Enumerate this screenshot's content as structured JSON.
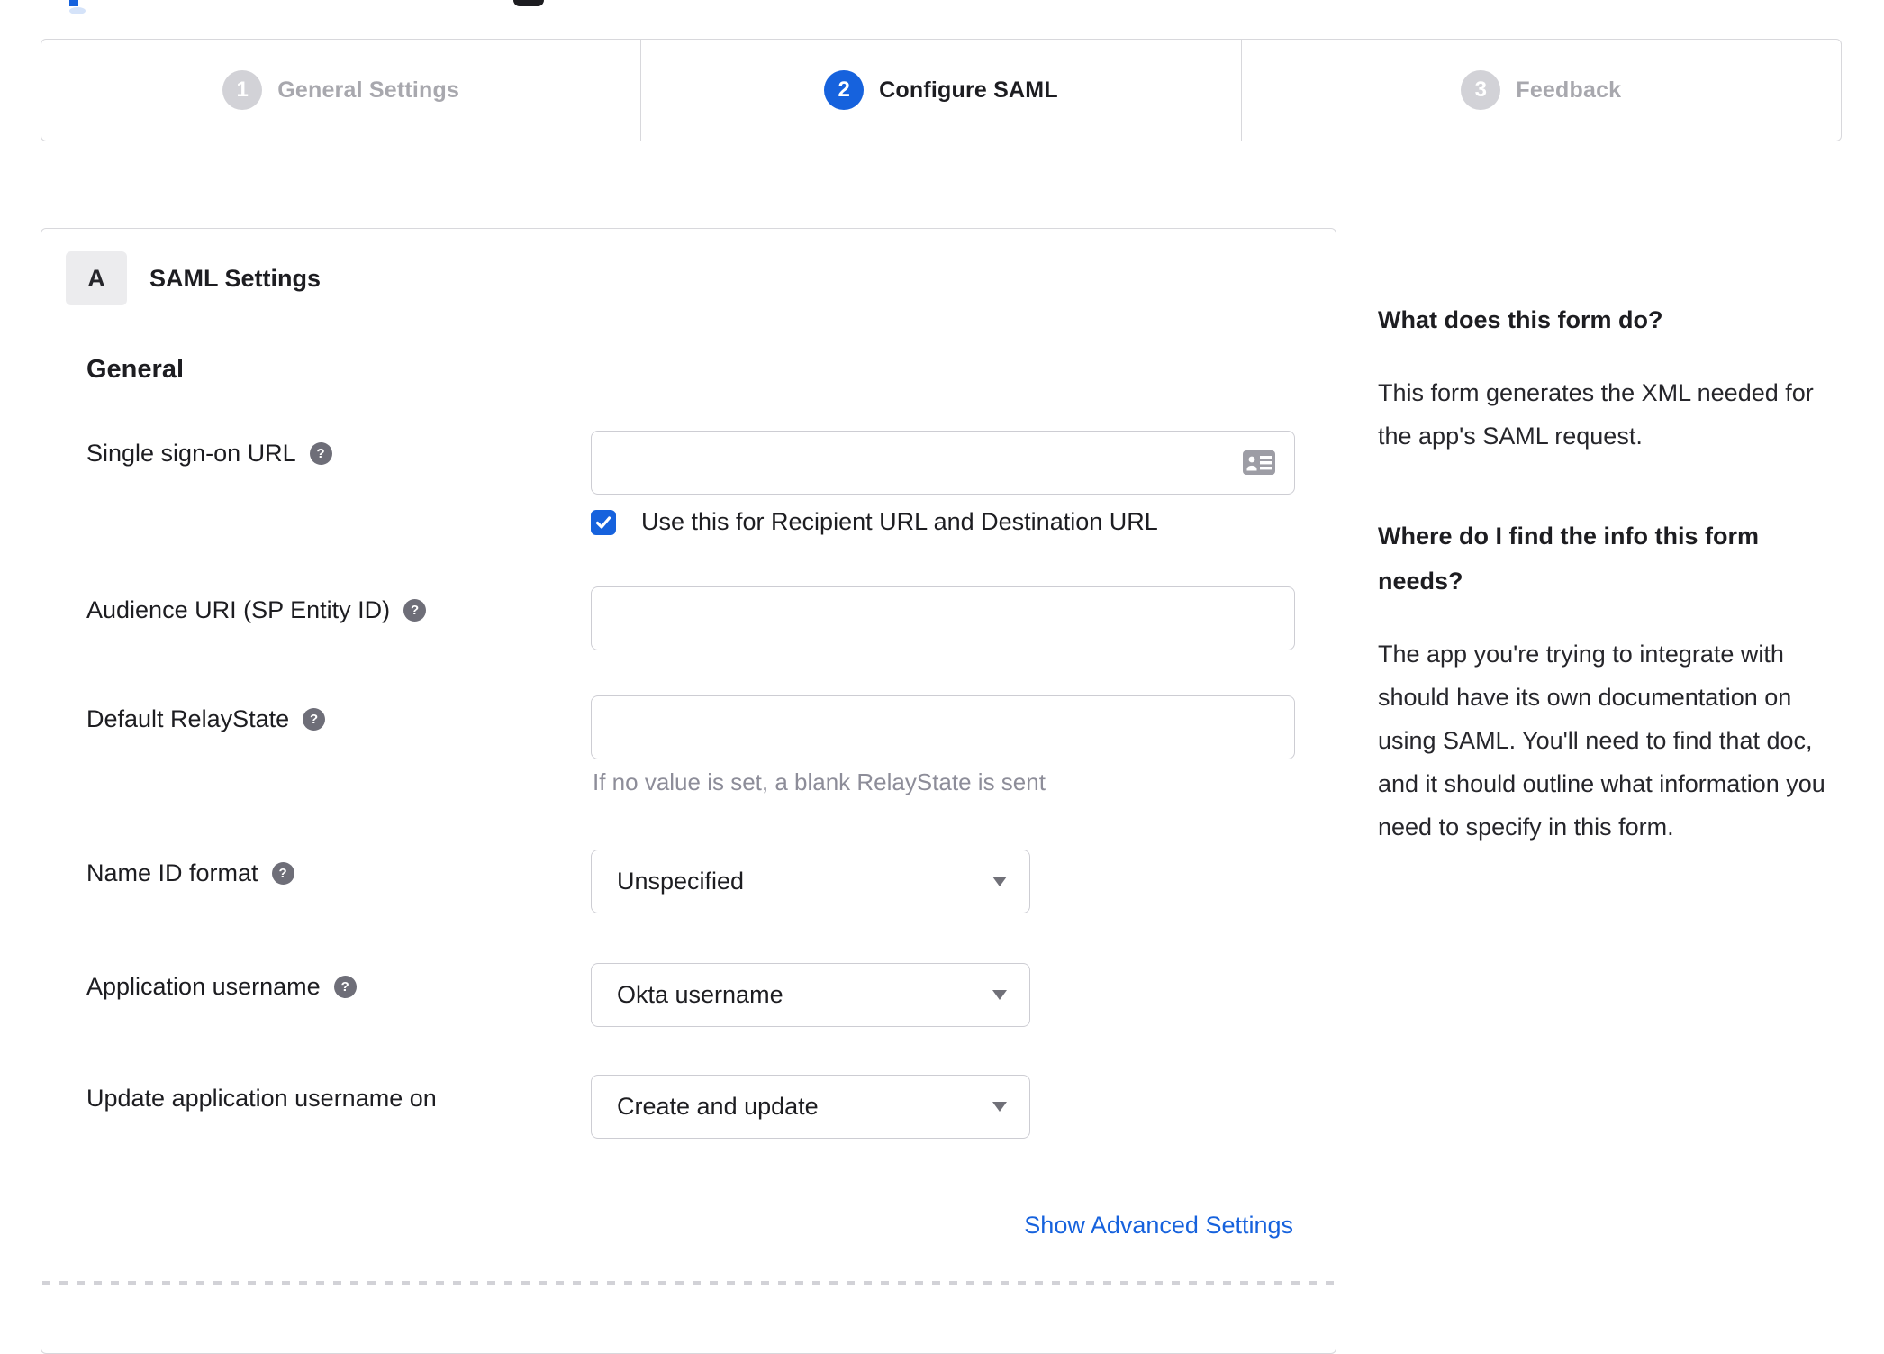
{
  "colors": {
    "accent_blue": "#1662dd",
    "inactive_gray": "#d2d2d7",
    "border_gray": "#d8d8dc",
    "help_icon_gray": "#6e6e78",
    "helper_text_gray": "#8d8d99",
    "text_dark": "#1d1d21"
  },
  "stepper": {
    "steps": [
      {
        "number": "1",
        "label": "General Settings",
        "state": "inactive"
      },
      {
        "number": "2",
        "label": "Configure SAML",
        "state": "active"
      },
      {
        "number": "3",
        "label": "Feedback",
        "state": "inactive"
      }
    ]
  },
  "panel": {
    "section_badge": "A",
    "section_title": "SAML Settings",
    "subsection_title": "General",
    "fields": {
      "sso": {
        "label": "Single sign-on URL",
        "value": "",
        "checkbox_label": "Use this for Recipient URL and Destination URL",
        "checkbox_checked": true
      },
      "audience": {
        "label": "Audience URI (SP Entity ID)",
        "value": ""
      },
      "relay": {
        "label": "Default RelayState",
        "value": "",
        "helper_text": "If no value is set, a blank RelayState is sent"
      },
      "name_id": {
        "label": "Name ID format",
        "value": "Unspecified"
      },
      "app_username": {
        "label": "Application username",
        "value": "Okta username"
      },
      "update_username": {
        "label": "Update application username on",
        "value": "Create and update"
      }
    },
    "advanced_link_label": "Show Advanced Settings"
  },
  "sidebar": {
    "heading1": "What does this form do?",
    "paragraph1": "This form generates the XML needed for the app's SAML request.",
    "heading2": "Where do I find the info this form needs?",
    "paragraph2": "The app you're trying to integrate with should have its own documentation on using SAML. You'll need to find that doc, and it should outline what information you need to specify in this form."
  },
  "icons": {
    "help": "question-mark-circle",
    "sso_field": "contact-card",
    "checkbox": "checkmark",
    "select": "caret-down"
  }
}
